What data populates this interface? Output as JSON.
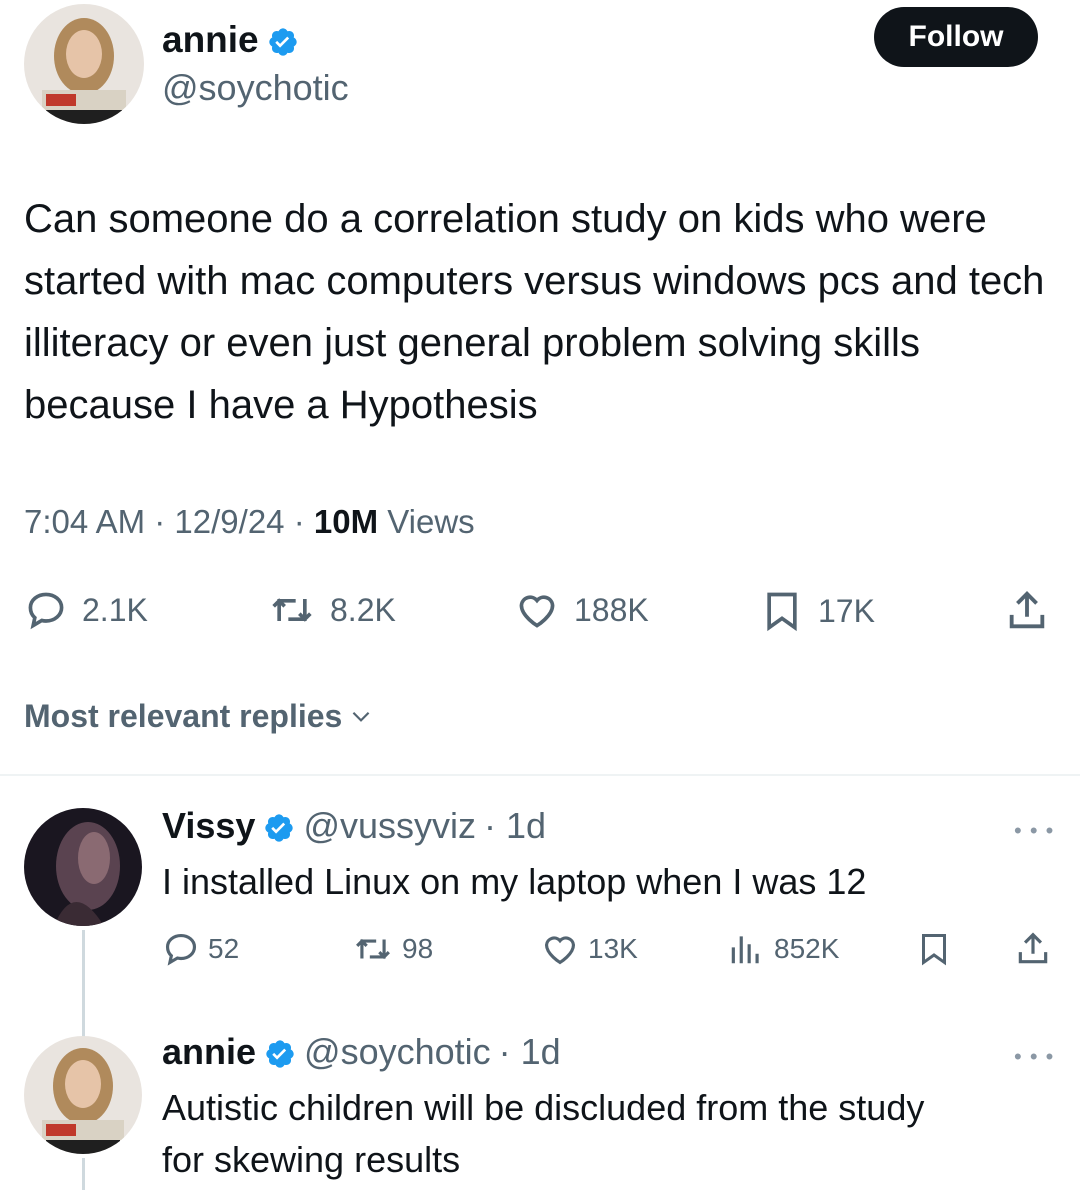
{
  "tweet": {
    "author_name": "annie",
    "author_handle": "@soychotic",
    "follow_label": "Follow",
    "text": "Can someone do a correlation study on kids who were started with mac computers versus windows pcs and tech illiteracy or even just general problem solving skills because I have a Hypothesis",
    "time": "7:04 AM",
    "date": "12/9/24",
    "views_count": "10M",
    "views_label": "Views",
    "separator": "·",
    "stats": {
      "replies": "2.1K",
      "reposts": "8.2K",
      "likes": "188K",
      "bookmarks": "17K"
    }
  },
  "replies_sort_label": "Most relevant replies",
  "replies": [
    {
      "name": "Vissy",
      "handle": "@vussyviz",
      "age": "· 1d",
      "text": "I installed Linux on my laptop when I was 12",
      "more": "• • •",
      "stats": {
        "replies": "52",
        "reposts": "98",
        "likes": "13K",
        "views": "852K"
      }
    },
    {
      "name": "annie",
      "handle": "@soychotic",
      "age": "· 1d",
      "text_line1": "Autistic children will be discluded from the study",
      "text_line2": "for skewing results",
      "more": "• • •"
    }
  ],
  "colors": {
    "text": "#0f1419",
    "secondary": "#536471",
    "verified": "#1d9bf0",
    "follow_bg": "#0f1419"
  }
}
